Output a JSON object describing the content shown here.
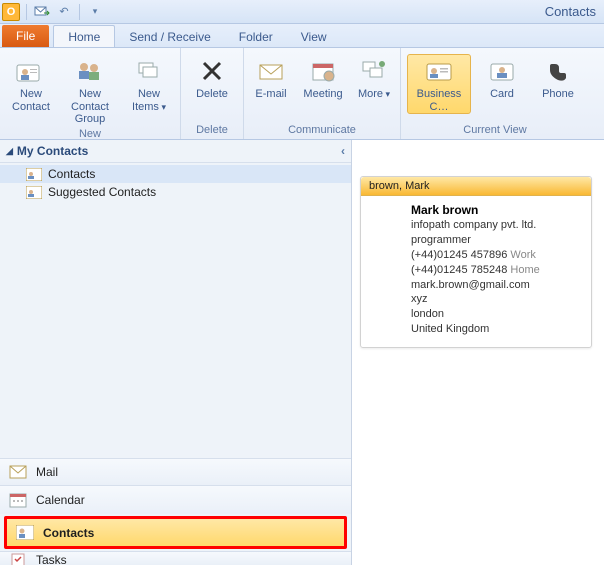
{
  "window": {
    "title": "Contacts"
  },
  "qat": {
    "app_letter": "O"
  },
  "tabs": {
    "file": "File",
    "home": "Home",
    "send_receive": "Send / Receive",
    "folder": "Folder",
    "view": "View"
  },
  "ribbon": {
    "groups": {
      "new": {
        "label": "New",
        "new_contact": "New Contact",
        "new_contact_group": "New Contact Group",
        "new_items": "New Items"
      },
      "delete": {
        "label": "Delete",
        "delete": "Delete"
      },
      "communicate": {
        "label": "Communicate",
        "email": "E-mail",
        "meeting": "Meeting",
        "more": "More"
      },
      "current_view": {
        "label": "Current View",
        "business_card": "Business C…",
        "card": "Card",
        "phone": "Phone"
      }
    }
  },
  "nav": {
    "header": "My Contacts",
    "items": [
      {
        "label": "Contacts"
      },
      {
        "label": "Suggested Contacts"
      }
    ],
    "bottom": {
      "mail": "Mail",
      "calendar": "Calendar",
      "contacts": "Contacts",
      "tasks": "Tasks"
    }
  },
  "card": {
    "header": "brown, Mark",
    "name": "Mark brown",
    "company": "infopath company pvt. ltd.",
    "title": "programmer",
    "phone_work": "(+44)01245 457896",
    "phone_work_lbl": "Work",
    "phone_home": "(+44)01245 785248",
    "phone_home_lbl": "Home",
    "email": "mark.brown@gmail.com",
    "line1": "xyz",
    "city": "london",
    "country": "United Kingdom"
  }
}
